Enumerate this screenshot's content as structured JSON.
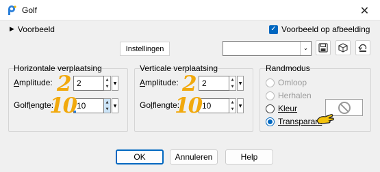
{
  "window": {
    "title": "Golf",
    "close_glyph": "✕"
  },
  "toolbar": {
    "preview_label": "Voorbeeld",
    "preview_on_image_label": "Voorbeeld op afbeelding",
    "preview_on_image_checked": true,
    "settings_label": "Instellingen",
    "preset_value": "",
    "icons": [
      "save-icon",
      "cube-icon",
      "reset-icon"
    ]
  },
  "horizontal": {
    "title": "Horizontale verplaatsing",
    "amplitude_label_pre": "A",
    "amplitude_label_rest": "mplitude:",
    "amplitude_value": "2",
    "wavelength_label_pre": "Golf",
    "wavelength_label_u": "l",
    "wavelength_label_rest": "engte:",
    "wavelength_value": "10",
    "annot_amplitude": "2",
    "annot_wavelength": "10"
  },
  "vertical": {
    "title": "Verticale verplaatsing",
    "amplitude_label_pre": "A",
    "amplitude_label_rest": "mplitude:",
    "amplitude_value": "2",
    "wavelength_label_pre": "Go",
    "wavelength_label_u": "l",
    "wavelength_label_rest": "flengte:",
    "wavelength_value": "10",
    "annot_amplitude": "2",
    "annot_wavelength": "10"
  },
  "edge_mode": {
    "title": "Randmodus",
    "options": [
      {
        "label": "Omloop",
        "state": "disabled"
      },
      {
        "label": "Herhalen",
        "state": "disabled"
      },
      {
        "label": "Kleur",
        "state": "normal"
      },
      {
        "label": "Transparant",
        "state": "selected"
      }
    ]
  },
  "buttons": {
    "ok": "OK",
    "cancel": "Annuleren",
    "help": "Help"
  },
  "colors": {
    "accent": "#0067c0",
    "annotation": "#f1a90d"
  }
}
